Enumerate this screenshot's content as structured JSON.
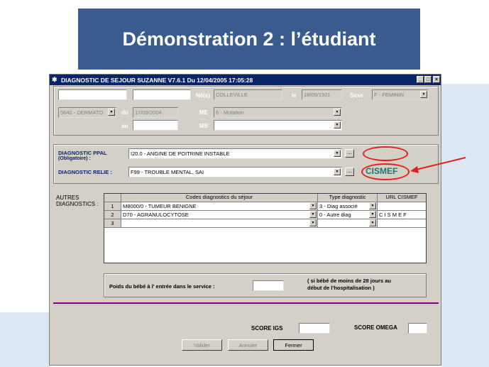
{
  "slide": {
    "title": "Démonstration 2 : l’étudiant"
  },
  "window": {
    "title": "DIAGNOSTIC DE SEJOUR  SUZANNE  V7.6.1 Du 12/04/2005 17:05:28",
    "controls": [
      "_",
      "□",
      "×"
    ]
  },
  "patient": {
    "nee_label": "Né(e)",
    "nee_value": "COLLEVILLE",
    "le_label": "le",
    "birth_date": "18/05/1921",
    "sexe_label": "Sexe",
    "sexe_value": "F - FEMININ",
    "service_value": "5642 - DERMATO.",
    "du_label": "du",
    "du_value": "17/09/2004",
    "au_label": "au",
    "me_label": "ME",
    "me_value": "6 - Mutation",
    "ms_label": "MS"
  },
  "diagnostics": {
    "ppal_label_line1": "DIAGNOSTIC PPAL",
    "ppal_label_line2": "(Obligatoire) :",
    "ppal_value": "I20.0 - ANGINE DE POITRINE INSTABLE",
    "relie_label": "DIAGNOSTIC RELIE :",
    "relie_value": "F99 - TROUBLE MENTAL, SAI",
    "dots_label": "...",
    "cismef_label": "CISMEF"
  },
  "autres": {
    "label_line1": "AUTRES",
    "label_line2": "DIAGNOSTICS :",
    "headers": [
      "Codes diagnostics du séjour",
      "Type diagnostic",
      "URL CISMEF"
    ],
    "rows": [
      {
        "num": "1",
        "code": "M8000/0 - TUMEUR BENIGNE",
        "type": "3 - Diag associé",
        "url": ""
      },
      {
        "num": "2",
        "code": "D70 - AGRANULOCYTOSE",
        "type": "0 - Autre diag",
        "url": "C I S M E F"
      },
      {
        "num": "3",
        "code": "",
        "type": "",
        "url": ""
      }
    ]
  },
  "bebe": {
    "poids_label": "Poids  du  bébé  à  l' entrée  dans  le  service :",
    "note_line1": "( si bébé de moins de 28 jours au",
    "note_line2": "début de l'hospitalisation )"
  },
  "scores": {
    "igs_label": "SCORE  IGS",
    "omega_label": "SCORE  OMEGA"
  },
  "buttons": {
    "valider": "Valider",
    "annuler": "Annuler",
    "fermer": "Fermer"
  },
  "colors": {
    "slide_title_bg": "#3b5b8e",
    "titlebar": "#0a246a",
    "cismef": "#1a7a6a",
    "highlight_red": "#e0201e",
    "separator": "#800080"
  }
}
